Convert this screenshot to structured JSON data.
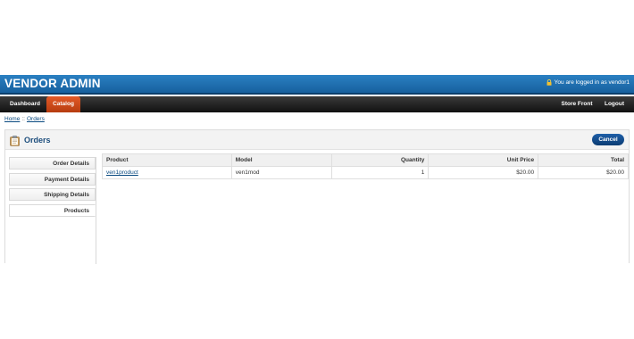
{
  "header": {
    "brand": "VENDOR ADMIN",
    "login_text": "You are logged in as vendor1"
  },
  "menu": {
    "dashboard": "Dashboard",
    "catalog": "Catalog",
    "store_front": "Store Front",
    "logout": "Logout"
  },
  "breadcrumb": {
    "home": "Home",
    "separator": "::",
    "orders": "Orders"
  },
  "panel": {
    "title": "Orders",
    "cancel_label": "Cancel"
  },
  "tabs": [
    {
      "label": "Order Details"
    },
    {
      "label": "Payment Details"
    },
    {
      "label": "Shipping Details"
    },
    {
      "label": "Products",
      "active": true
    }
  ],
  "products_table": {
    "headers": {
      "product": "Product",
      "model": "Model",
      "quantity": "Quantity",
      "unit_price": "Unit Price",
      "total": "Total"
    },
    "rows": [
      {
        "product": "ven1product",
        "model": "ven1mod",
        "quantity": "1",
        "unit_price": "$20.00",
        "total": "$20.00"
      }
    ]
  },
  "colors": {
    "header_blue": "#17609e",
    "menu_black": "#111111",
    "active_menu_orange": "#d9501e",
    "title_blue": "#1d4e7d",
    "button_blue": "#0b3c73"
  },
  "icons": {
    "login": "lock-icon",
    "panel": "clipboard-icon"
  }
}
